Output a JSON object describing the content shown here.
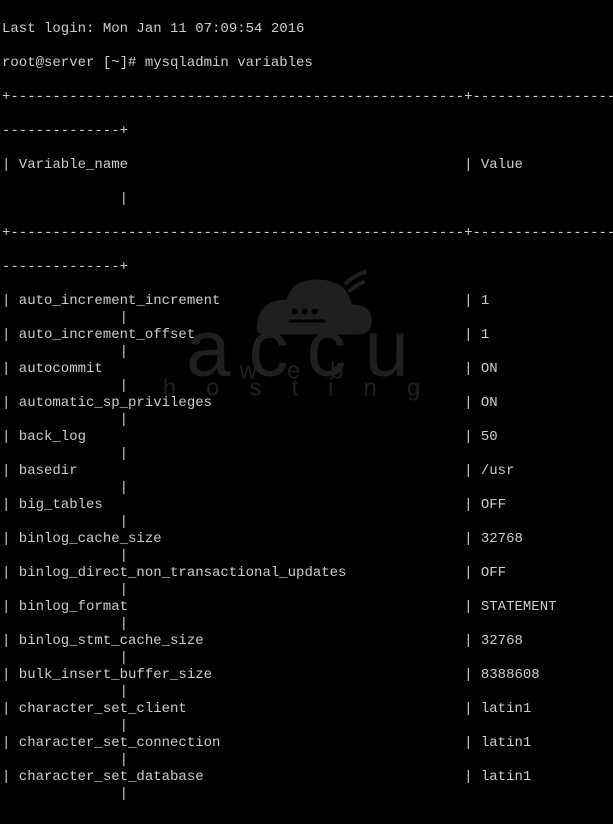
{
  "session": {
    "last_login": "Last login: Mon Jan 11 07:09:54 2016",
    "prompt": "root@server [~]# mysqladmin variables"
  },
  "table": {
    "border_top": "+------------------------------------------------------+-----------------------",
    "border_cont": "--------------+",
    "header_name": "| Variable_name                                        | Value",
    "header_cont": "              |",
    "rows": [
      {
        "name": "auto_increment_increment",
        "value": "1"
      },
      {
        "name": "auto_increment_offset",
        "value": "1"
      },
      {
        "name": "autocommit",
        "value": "ON"
      },
      {
        "name": "automatic_sp_privileges",
        "value": "ON"
      },
      {
        "name": "back_log",
        "value": "50"
      },
      {
        "name": "basedir",
        "value": "/usr"
      },
      {
        "name": "big_tables",
        "value": "OFF"
      },
      {
        "name": "binlog_cache_size",
        "value": "32768"
      },
      {
        "name": "binlog_direct_non_transactional_updates",
        "value": "OFF"
      },
      {
        "name": "binlog_format",
        "value": "STATEMENT"
      },
      {
        "name": "binlog_stmt_cache_size",
        "value": "32768"
      },
      {
        "name": "bulk_insert_buffer_size",
        "value": "8388608"
      },
      {
        "name": "character_set_client",
        "value": "latin1"
      },
      {
        "name": "character_set_connection",
        "value": "latin1"
      },
      {
        "name": "character_set_database",
        "value": "latin1"
      }
    ]
  },
  "watermark": {
    "main": "accu",
    "sub": "web hosting"
  }
}
